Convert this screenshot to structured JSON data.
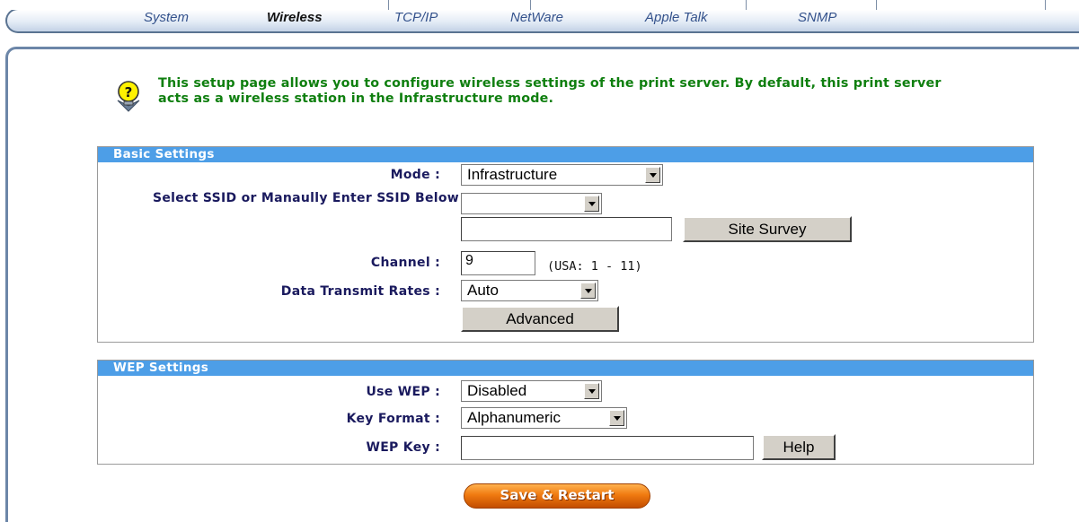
{
  "nav": {
    "tabs": [
      {
        "label": "System",
        "active": false
      },
      {
        "label": "Wireless",
        "active": true
      },
      {
        "label": "TCP/IP",
        "active": false
      },
      {
        "label": "NetWare",
        "active": false
      },
      {
        "label": "Apple Talk",
        "active": false
      },
      {
        "label": "SNMP",
        "active": false
      }
    ]
  },
  "intro": {
    "icon": "bulb-info-icon",
    "text": "This setup page allows you to configure wireless settings of the print server. By default, this print server acts as a wireless station in the Infrastructure mode."
  },
  "basic": {
    "header": "Basic Settings",
    "mode_label": "Mode :",
    "mode_value": "Infrastructure",
    "ssid_label": "Select SSID or Manaully Enter SSID Below :",
    "ssid_select_value": "",
    "ssid_input_value": "",
    "site_survey_label": "Site Survey",
    "channel_label": "Channel :",
    "channel_value": "9",
    "channel_hint": "(USA: 1 - 11)",
    "rate_label": "Data Transmit Rates :",
    "rate_value": "Auto",
    "advanced_label": "Advanced"
  },
  "wep": {
    "header": "WEP Settings",
    "use_wep_label": "Use WEP :",
    "use_wep_value": "Disabled",
    "key_format_label": "Key Format :",
    "key_format_value": "Alphanumeric",
    "wep_key_label": "WEP Key :",
    "wep_key_value": "",
    "help_label": "Help"
  },
  "save_label": "Save & Restart",
  "colors": {
    "intro_text": "#0f7f0f",
    "section_header": "#4d9ee7",
    "label_text": "#1a1a5e",
    "save_button": "#f07a10"
  }
}
